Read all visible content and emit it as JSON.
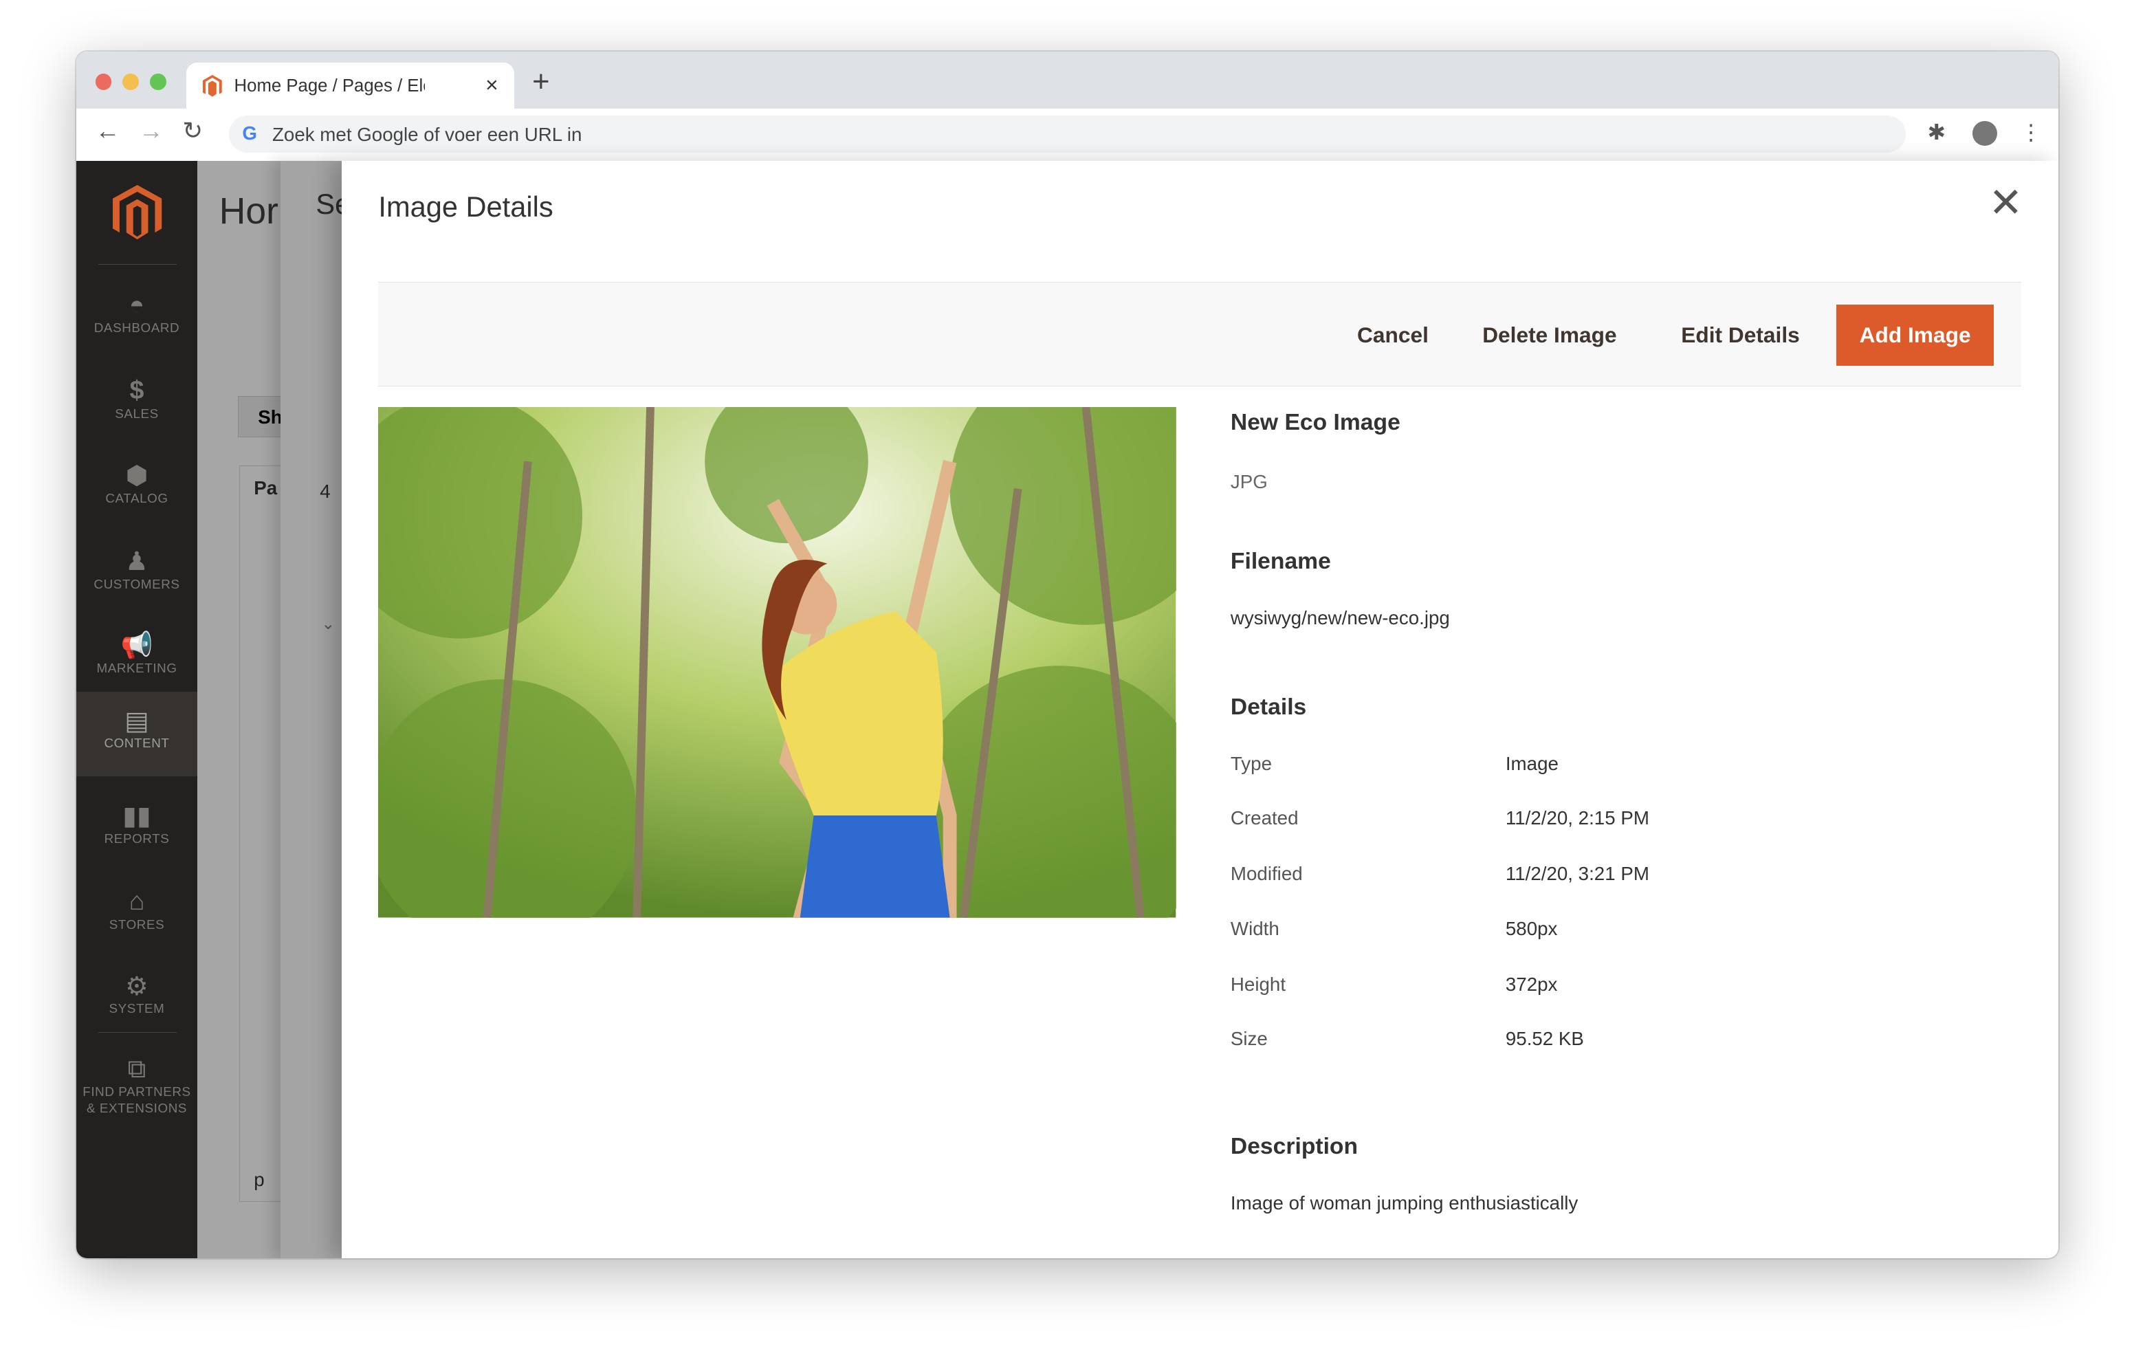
{
  "browser": {
    "tab_title": "Home Page / Pages / Elements",
    "address_placeholder": "Zoek met Google of voer een URL in",
    "icons": [
      "back-icon",
      "forward-icon",
      "reload-icon",
      "google-icon",
      "extensions-icon",
      "profile-avatar",
      "menu-icon"
    ]
  },
  "sidebar": {
    "items": [
      {
        "label": "DASHBOARD",
        "icon": "dashboard-icon"
      },
      {
        "label": "SALES",
        "icon": "dollar-icon"
      },
      {
        "label": "CATALOG",
        "icon": "box-icon"
      },
      {
        "label": "CUSTOMERS",
        "icon": "person-icon"
      },
      {
        "label": "MARKETING",
        "icon": "megaphone-icon"
      },
      {
        "label": "CONTENT",
        "icon": "layout-icon",
        "active": true
      },
      {
        "label": "REPORTS",
        "icon": "bar-chart-icon"
      },
      {
        "label": "STORES",
        "icon": "store-icon"
      },
      {
        "label": "SYSTEM",
        "icon": "gear-icon"
      },
      {
        "label": "FIND PARTNERS & EXTENSIONS",
        "icon": "blocks-icon"
      }
    ]
  },
  "background": {
    "title": "Hor",
    "title2": "Se",
    "btn": "Sh",
    "col": "Pa",
    "num": "4",
    "footer": "p"
  },
  "modal": {
    "title": "Image Details",
    "buttons": {
      "cancel": "Cancel",
      "delete": "Delete Image",
      "edit": "Edit Details",
      "add": "Add Image"
    },
    "accent": "#dd5a2b",
    "image_name": "New Eco Image",
    "image_type": "JPG",
    "filename_heading": "Filename",
    "filename": "wysiwyg/new/new-eco.jpg",
    "details_heading": "Details",
    "details": [
      {
        "label": "Type",
        "value": "Image"
      },
      {
        "label": "Created",
        "value": "11/2/20, 2:15 PM"
      },
      {
        "label": "Modified",
        "value": "11/2/20, 3:21 PM"
      },
      {
        "label": "Width",
        "value": "580px"
      },
      {
        "label": "Height",
        "value": "372px"
      },
      {
        "label": "Size",
        "value": "95.52 KB"
      }
    ],
    "description_heading": "Description",
    "description": "Image of woman jumping enthusiastically"
  }
}
